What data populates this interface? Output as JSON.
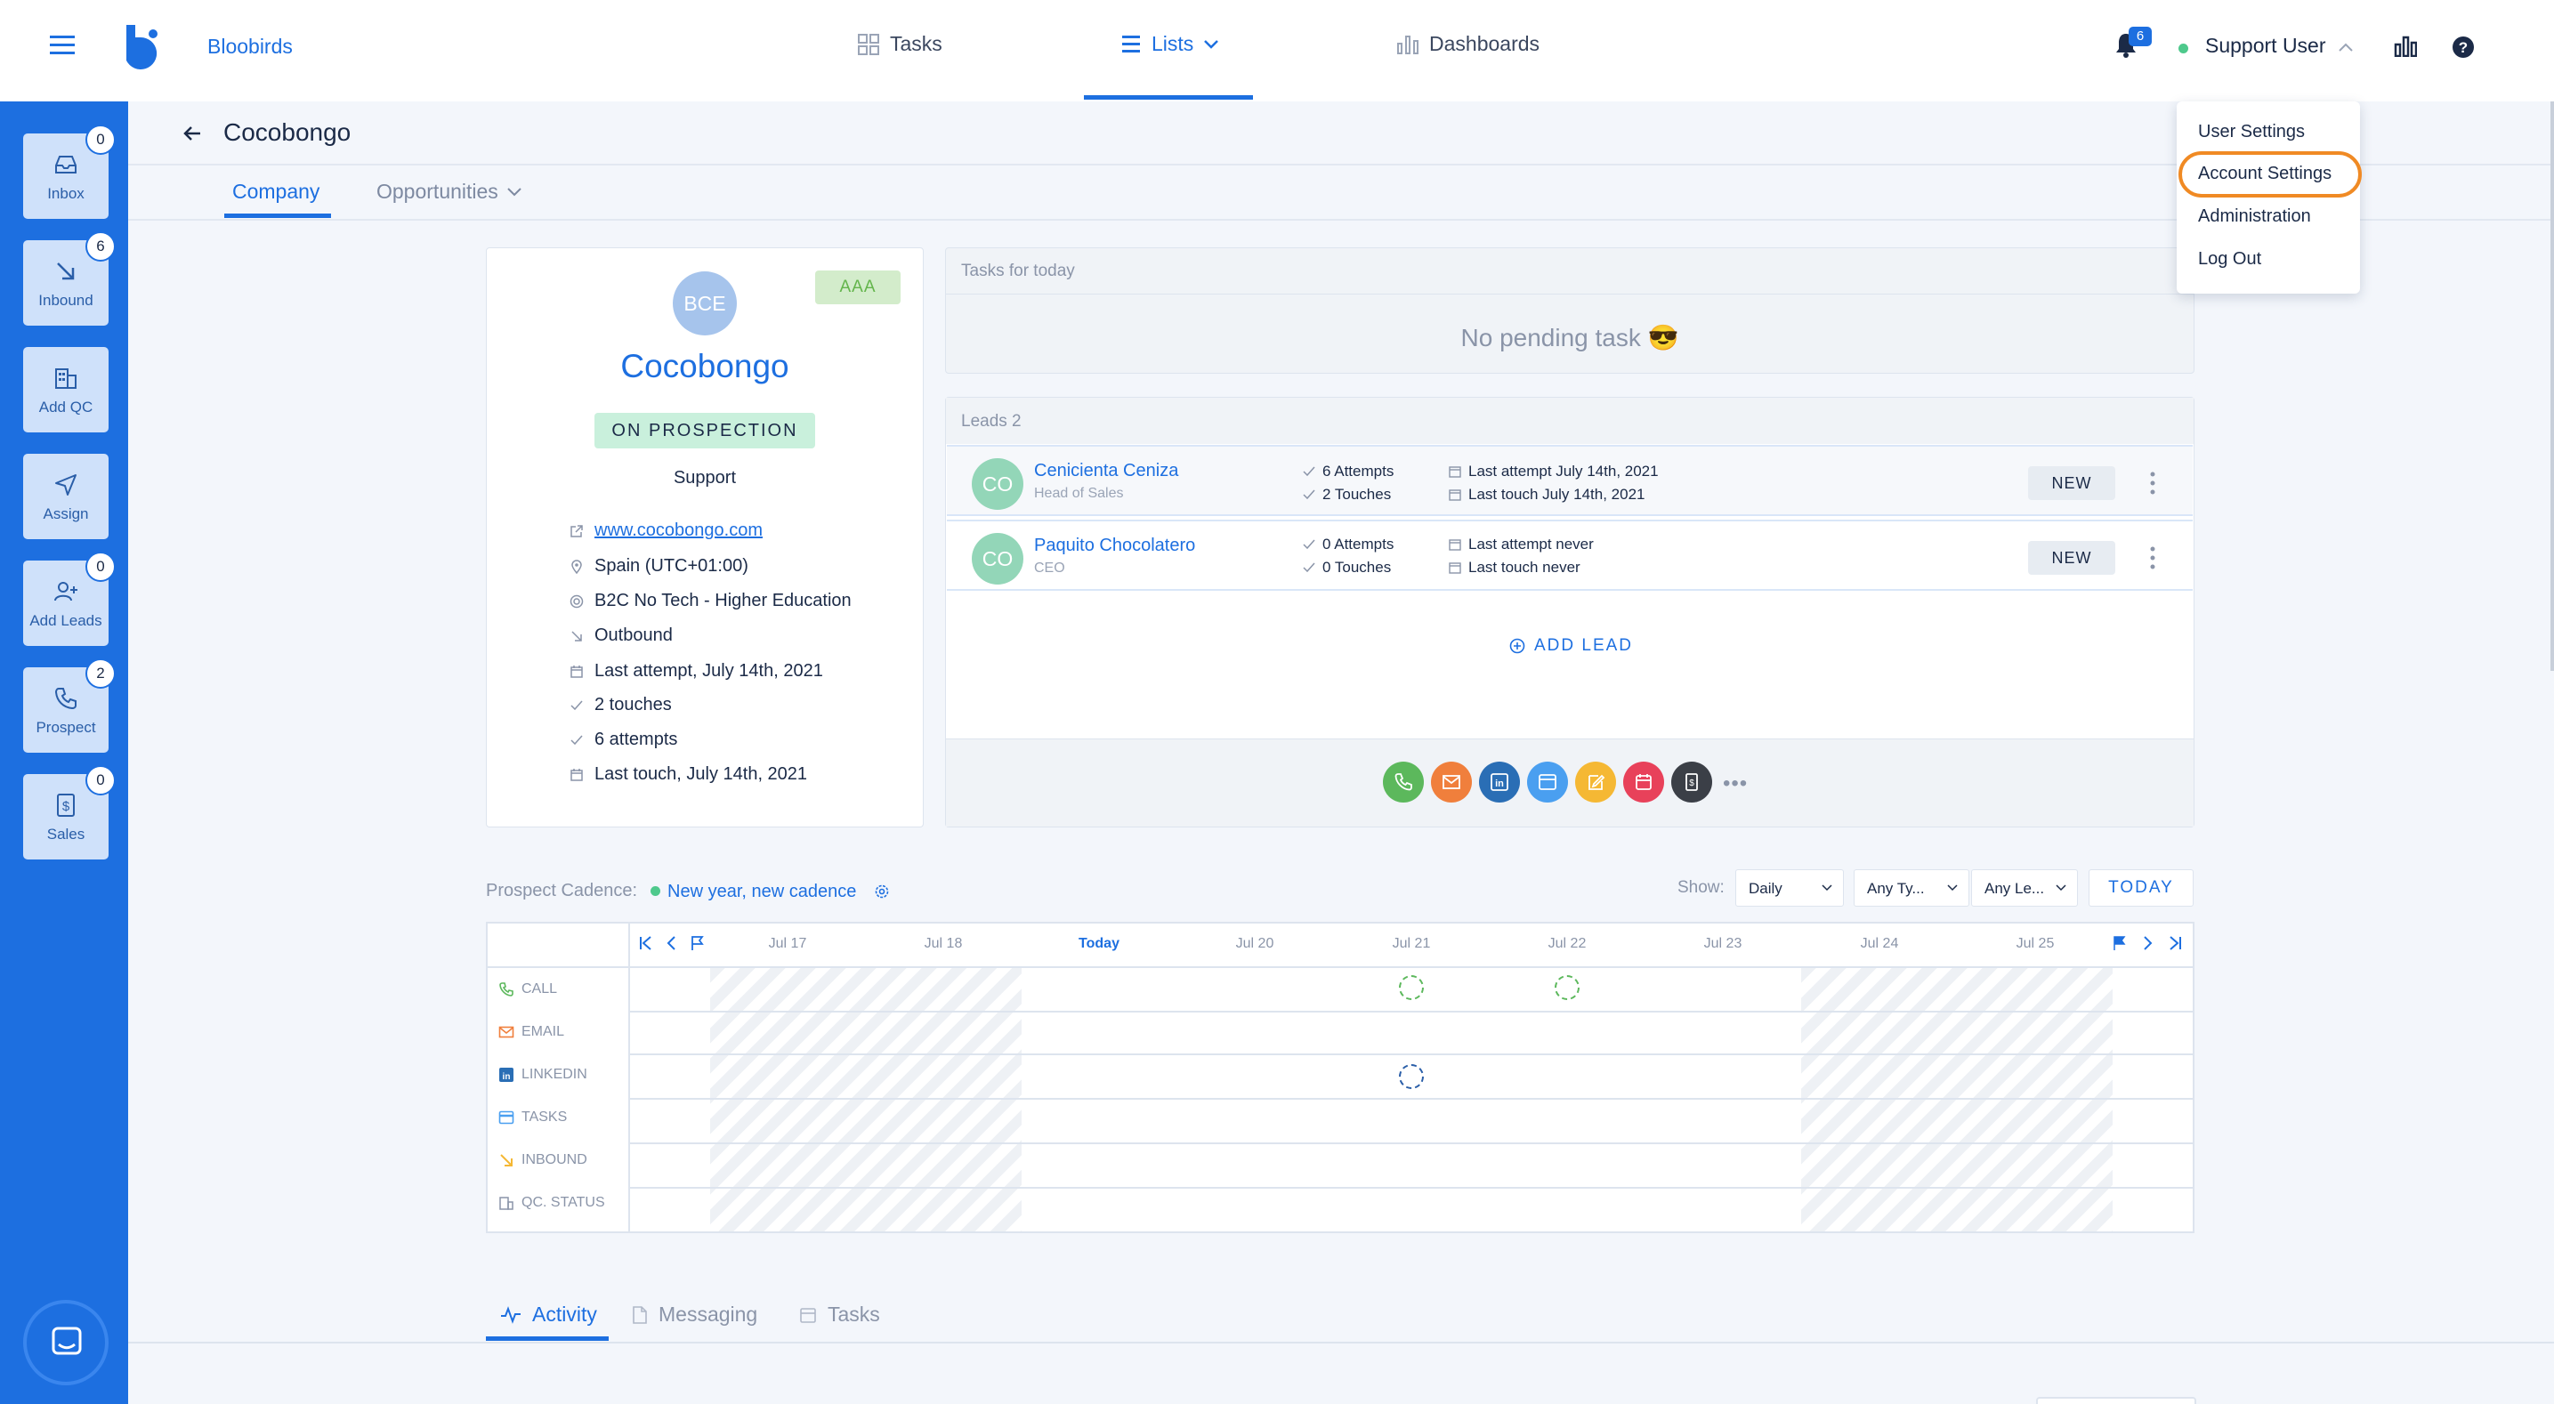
{
  "header": {
    "brand": "Bloobirds",
    "nav": [
      {
        "label": "Tasks",
        "icon": "grid-icon"
      },
      {
        "label": "Lists",
        "icon": "list-icon",
        "active": true
      },
      {
        "label": "Dashboards",
        "icon": "bar-chart-icon"
      }
    ],
    "notifications_count": "6",
    "user_name": "Support User",
    "user_menu": [
      "User Settings",
      "Account Settings",
      "Administration",
      "Log Out"
    ],
    "highlighted_menu_item": "Account Settings"
  },
  "sidebar": {
    "items": [
      {
        "label": "Inbox",
        "badge": "0",
        "icon": "inbox-icon"
      },
      {
        "label": "Inbound",
        "badge": "6",
        "icon": "arrow-down-right-icon"
      },
      {
        "label": "Add QC",
        "badge": "",
        "icon": "building-icon"
      },
      {
        "label": "Assign",
        "badge": "",
        "icon": "send-icon"
      },
      {
        "label": "Add Leads",
        "badge": "0",
        "icon": "add-person-icon"
      },
      {
        "label": "Prospect",
        "badge": "2",
        "icon": "phone-icon"
      },
      {
        "label": "Sales",
        "badge": "0",
        "icon": "dollar-icon"
      }
    ]
  },
  "page": {
    "title": "Cocobongo",
    "tabs": [
      {
        "label": "Company",
        "active": true
      },
      {
        "label": "Opportunities",
        "active": false
      }
    ]
  },
  "company": {
    "initials": "BCE",
    "tier": "AAA",
    "name": "Cocobongo",
    "status": "ON PROSPECTION",
    "owner": "Support",
    "website": "www.cocobongo.com",
    "location": "Spain (UTC+01:00)",
    "segment": "B2C No Tech - Higher Education",
    "source": "Outbound",
    "last_attempt": "Last attempt, July 14th, 2021",
    "touches": "2 touches",
    "attempts": "6 attempts",
    "last_touch": "Last touch, July 14th, 2021"
  },
  "tasks": {
    "header": "Tasks for today",
    "empty": "No pending task 😎"
  },
  "leads": {
    "header": "Leads 2",
    "rows": [
      {
        "initials": "CO",
        "name": "Cenicienta Ceniza",
        "role": "Head of Sales",
        "attempts": "6 Attempts",
        "touches": "2 Touches",
        "last_attempt": "Last attempt July 14th, 2021",
        "last_touch": "Last touch July 14th, 2021",
        "status": "NEW"
      },
      {
        "initials": "CO",
        "name": "Paquito Chocolatero",
        "role": "CEO",
        "attempts": "0 Attempts",
        "touches": "0 Touches",
        "last_attempt": "Last attempt never",
        "last_touch": "Last touch never",
        "status": "NEW"
      }
    ],
    "add_lead": "ADD LEAD",
    "actions": [
      {
        "name": "call",
        "color": "#5cb85c"
      },
      {
        "name": "email",
        "color": "#f07f3c"
      },
      {
        "name": "linkedin",
        "color": "#2a6eb5"
      },
      {
        "name": "task",
        "color": "#4a9ff0"
      },
      {
        "name": "note",
        "color": "#f5b834"
      },
      {
        "name": "meeting",
        "color": "#e8415a"
      },
      {
        "name": "sales",
        "color": "#3b3f47"
      }
    ]
  },
  "cadence": {
    "label": "Prospect Cadence:",
    "name": "New year, new cadence",
    "show_label": "Show:",
    "filters": [
      "Daily",
      "Any Ty...",
      "Any Le..."
    ],
    "today_button": "TODAY",
    "days": [
      "Jul 17",
      "Jul 18",
      "Today",
      "Jul 20",
      "Jul 21",
      "Jul 22",
      "Jul 23",
      "Jul 24",
      "Jul 25"
    ],
    "channels": [
      {
        "label": "CALL",
        "icon": "phone-icon",
        "color": "#5cb85c"
      },
      {
        "label": "EMAIL",
        "icon": "mail-icon",
        "color": "#f07f3c"
      },
      {
        "label": "LINKEDIN",
        "icon": "linkedin-icon",
        "color": "#2a6eb5"
      },
      {
        "label": "TASKS",
        "icon": "task-icon",
        "color": "#4a9ff0"
      },
      {
        "label": "INBOUND",
        "icon": "inbound-icon",
        "color": "#f5b834"
      },
      {
        "label": "QC. STATUS",
        "icon": "building-icon",
        "color": "#8a94a8"
      }
    ],
    "scheduled": [
      {
        "channel": "CALL",
        "day": "Jul 21"
      },
      {
        "channel": "CALL",
        "day": "Jul 22"
      },
      {
        "channel": "LINKEDIN",
        "day": "Jul 21"
      }
    ]
  },
  "bottom_tabs": [
    {
      "label": "Activity",
      "active": true
    },
    {
      "label": "Messaging",
      "active": false
    },
    {
      "label": "Tasks",
      "active": false
    }
  ]
}
